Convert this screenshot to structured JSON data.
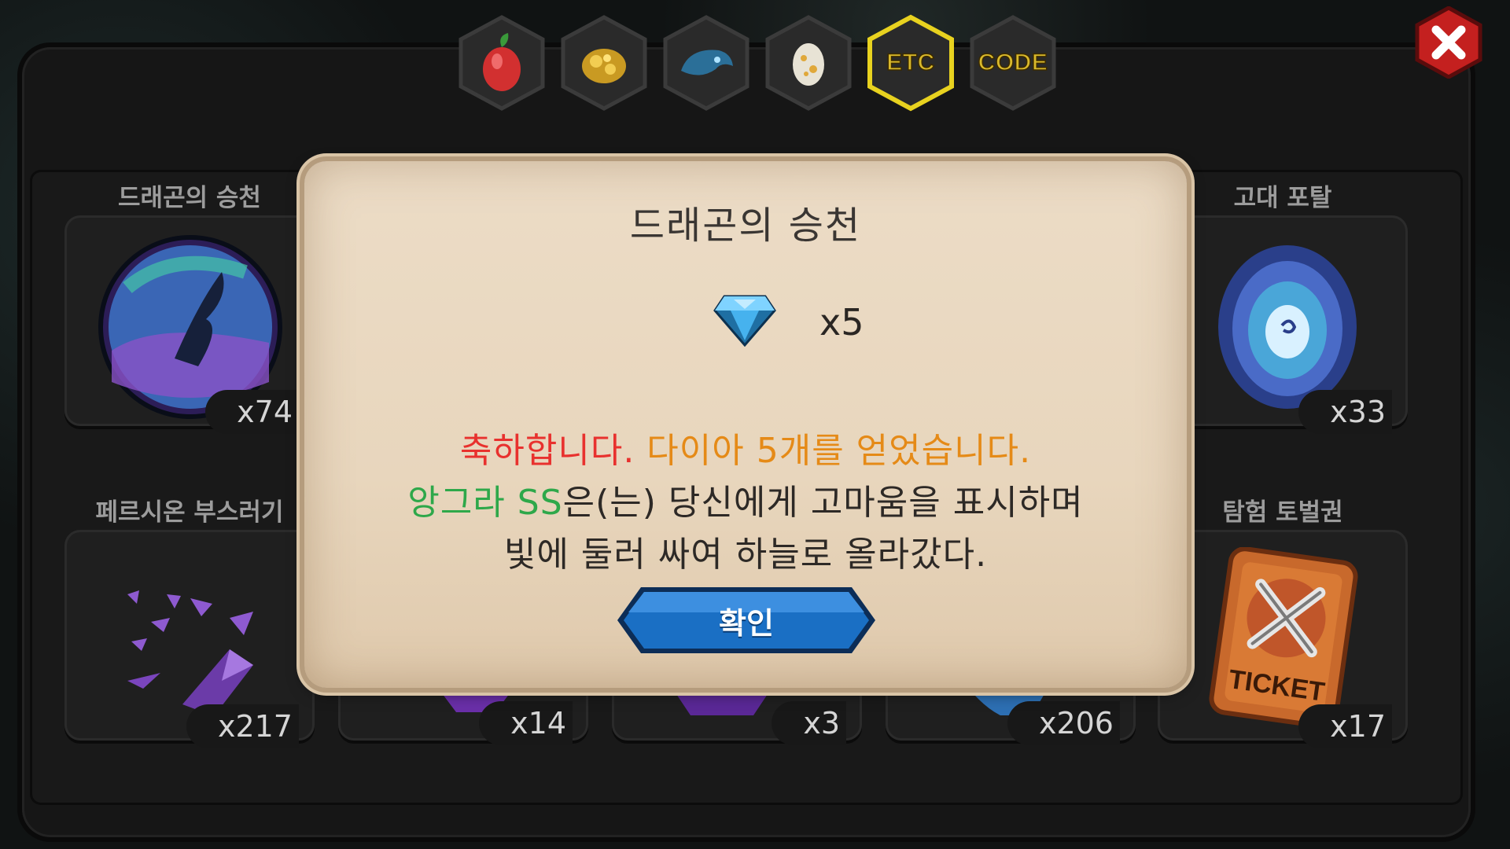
{
  "tabs": [
    {
      "name": "fruit",
      "label": ""
    },
    {
      "name": "gold",
      "label": ""
    },
    {
      "name": "dragon",
      "label": ""
    },
    {
      "name": "egg",
      "label": ""
    },
    {
      "name": "etc",
      "label": "ETC",
      "active": true
    },
    {
      "name": "code",
      "label": "CODE"
    }
  ],
  "items": [
    {
      "name": "드래곤의 승천",
      "count": "x74",
      "icon": "dragon-orb-icon"
    },
    {
      "name": "고대 포탈",
      "count": "x33",
      "icon": "portal-icon"
    },
    {
      "name": "페르시온 부스러기",
      "count": "x217",
      "icon": "crystal-shards-icon"
    },
    {
      "name": "",
      "count": "x14",
      "icon": "purple-crystal-icon"
    },
    {
      "name": "",
      "count": "x3",
      "icon": "purple-crystal-icon"
    },
    {
      "name": "",
      "count": "x206",
      "icon": "blue-item-icon"
    },
    {
      "name": "탐험 토벌권",
      "count": "x17",
      "icon": "ticket-icon",
      "ticket_text": "TICKET"
    }
  ],
  "modal": {
    "title": "드래곤의 승천",
    "reward_icon": "diamond-icon",
    "reward_amount": "x5",
    "line1_red": "축하합니다. ",
    "line1_orange": "다이아 5개를 얻었습니다.",
    "line2_green": "앙그라 SS",
    "line2_rest": "은(는) 당신에게 고마움을 표시하며",
    "line3": "빛에 둘러 싸여 하늘로 올라갔다.",
    "confirm_label": "확인"
  },
  "colors": {
    "accent_gold": "#d9b92c",
    "red_text": "#e8312e",
    "orange_text": "#e58a17",
    "green_text": "#2ea84a",
    "button_blue": "#1a6fc4"
  }
}
